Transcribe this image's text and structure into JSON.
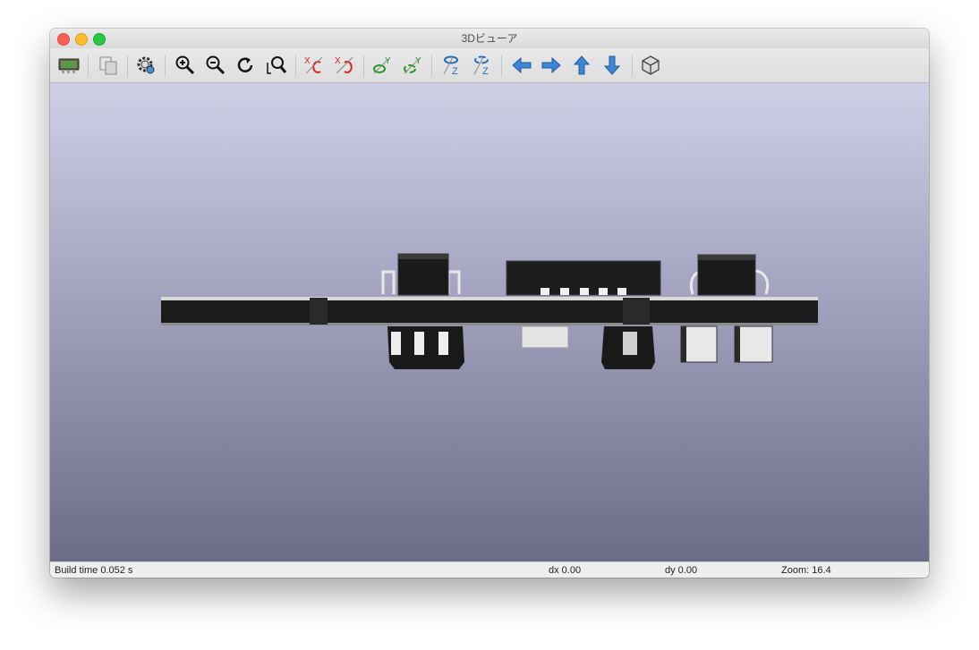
{
  "window": {
    "title": "3Dビューア"
  },
  "toolbar": {
    "buttons": [
      {
        "name": "reload-board-button",
        "icon": "reload-board-icon"
      },
      {
        "name": "copy-image-button",
        "icon": "copy-icon"
      },
      {
        "name": "settings-button",
        "icon": "gear-icon"
      },
      {
        "name": "zoom-in-button",
        "icon": "zoom-in-icon"
      },
      {
        "name": "zoom-out-button",
        "icon": "zoom-out-icon"
      },
      {
        "name": "redraw-button",
        "icon": "redraw-icon"
      },
      {
        "name": "zoom-fit-button",
        "icon": "zoom-fit-icon"
      },
      {
        "name": "rotate-x-cw-button",
        "icon": "rotate-x-cw-icon",
        "axis": "X"
      },
      {
        "name": "rotate-x-ccw-button",
        "icon": "rotate-x-ccw-icon",
        "axis": "X"
      },
      {
        "name": "rotate-y-cw-button",
        "icon": "rotate-y-cw-icon",
        "axis": "Y"
      },
      {
        "name": "rotate-y-ccw-button",
        "icon": "rotate-y-ccw-icon",
        "axis": "Y"
      },
      {
        "name": "rotate-z-cw-button",
        "icon": "rotate-z-cw-icon",
        "axis": "Z"
      },
      {
        "name": "rotate-z-ccw-button",
        "icon": "rotate-z-ccw-icon",
        "axis": "Z"
      },
      {
        "name": "move-left-button",
        "icon": "arrow-left-icon"
      },
      {
        "name": "move-right-button",
        "icon": "arrow-right-icon"
      },
      {
        "name": "move-up-button",
        "icon": "arrow-up-icon"
      },
      {
        "name": "move-down-button",
        "icon": "arrow-down-icon"
      },
      {
        "name": "toggle-ortho-button",
        "icon": "cube-icon"
      }
    ],
    "colors": {
      "x_axis": "#e02020",
      "y_axis": "#1f9a1f",
      "z_axis": "#1e6fc0",
      "arrow": "#3b86d6"
    }
  },
  "status": {
    "build_time": "Build time 0.052 s",
    "dx": "dx 0.00",
    "dy": "dy 0.00",
    "zoom": "Zoom: 16.4"
  }
}
